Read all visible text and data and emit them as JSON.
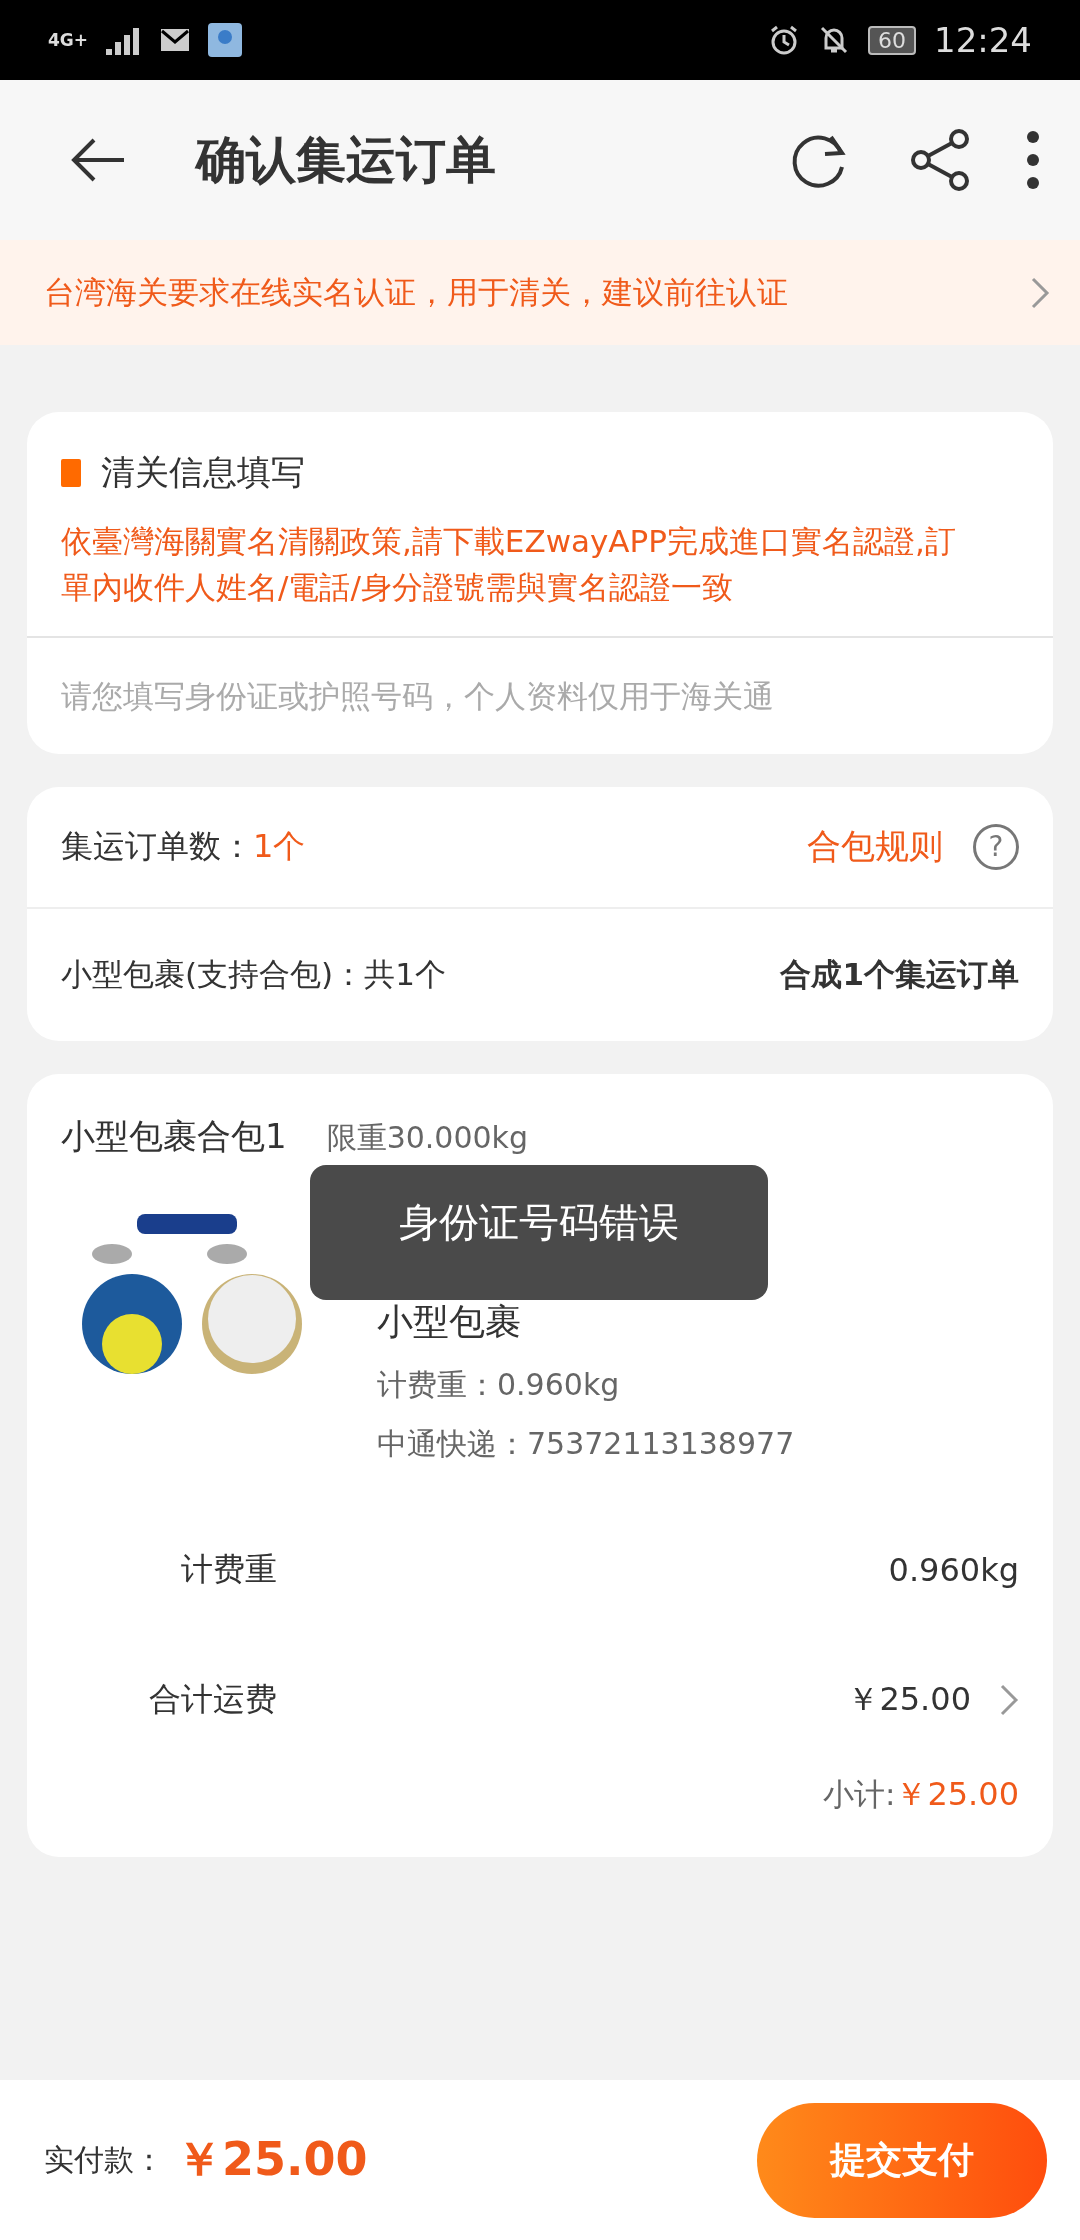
{
  "status_bar": {
    "network": "4G+",
    "battery": "60",
    "time": "12:24"
  },
  "header": {
    "title": "确认集运订单"
  },
  "notice": {
    "text": "台湾海关要求在线实名认证，用于清关，建议前往认证"
  },
  "customs_card": {
    "title": "清关信息填写",
    "warning": "依臺灣海關實名清關政策,請下載EZwayAPP完成進口實名認證,訂單內收件人姓名/電話/身分證號需與實名認證一致",
    "id_field": {
      "placeholder": "请您填写身份证或护照号码，个人资料仅用于海关通"
    }
  },
  "orders_card": {
    "count_label": "集运订单数：",
    "count_value": "1个",
    "rules_link": "合包规则",
    "help": "?",
    "package_type": "小型包裹(支持合包)：共1个",
    "merge_result": "合成1个集运订单"
  },
  "package_card": {
    "title": "小型包裹合包1",
    "limit": "限重30.000kg",
    "item": {
      "name": "小型包裹",
      "weight": "计费重：0.960kg",
      "tracking": "中通快递：75372113138977"
    },
    "rows": [
      {
        "label": "计费重",
        "value": "0.960kg",
        "has_arrow": false
      },
      {
        "label": "合计运费",
        "value": "￥25.00",
        "has_arrow": true
      }
    ],
    "subtotal_label": "小计:",
    "subtotal_value": "￥25.00"
  },
  "footer": {
    "paid_label": "实付款：",
    "paid_value": "￥25.00",
    "submit": "提交支付"
  },
  "toast": {
    "text": "身份证号码错误"
  }
}
